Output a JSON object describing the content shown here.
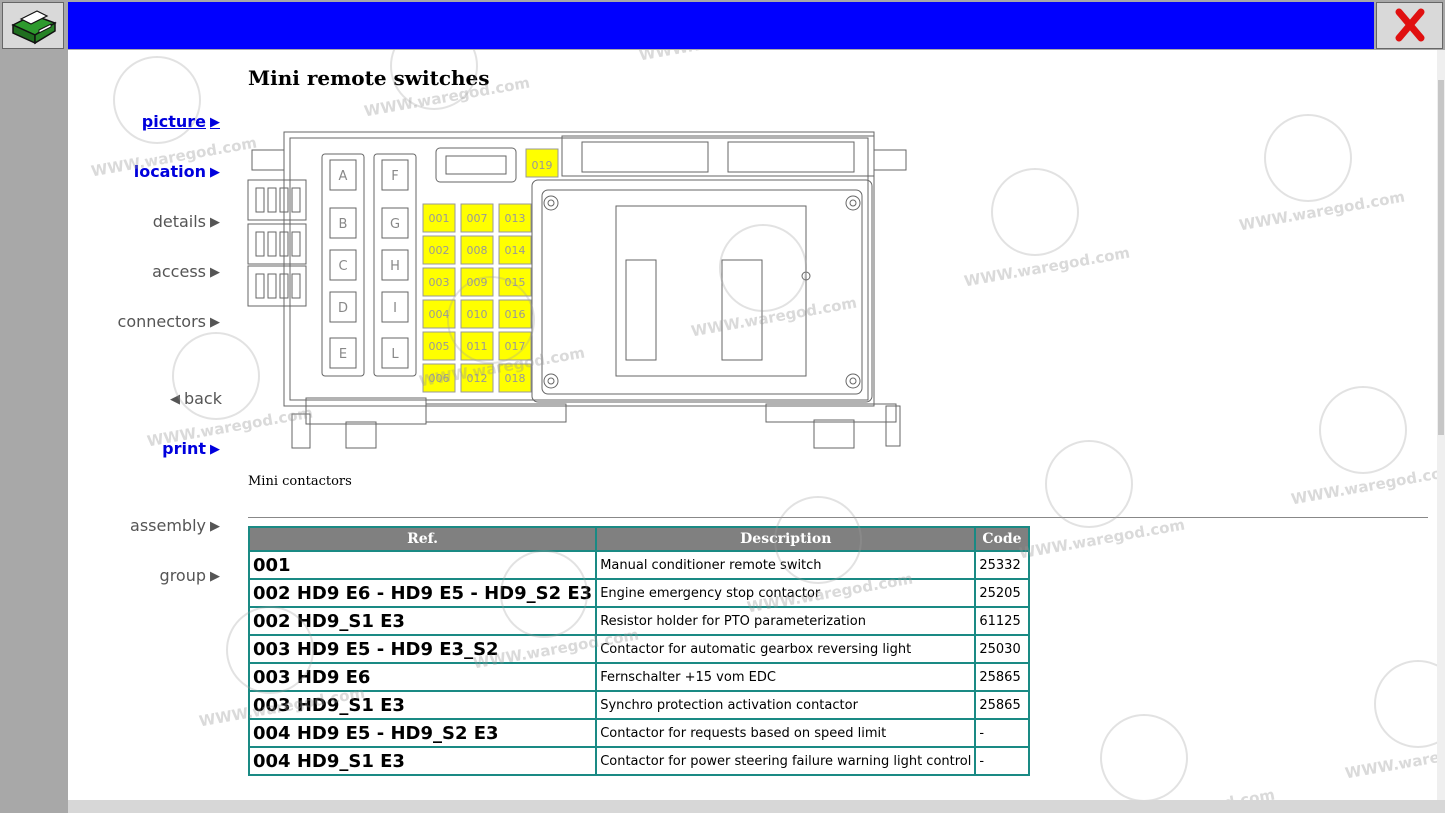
{
  "nav": {
    "picture": "picture",
    "location": "location",
    "details": "details",
    "access": "access",
    "connectors": "connectors",
    "back": "back",
    "print": "print",
    "assembly": "assembly",
    "group": "group"
  },
  "page": {
    "title": "Mini remote switches",
    "caption": "Mini contactors"
  },
  "diagram": {
    "fuse_labels_left": [
      "A",
      "B",
      "C",
      "D",
      "E"
    ],
    "fuse_labels_right": [
      "F",
      "G",
      "H",
      "I",
      "L"
    ],
    "yellow_labels": [
      "001",
      "007",
      "013",
      "002",
      "008",
      "014",
      "003",
      "009",
      "015",
      "004",
      "010",
      "016",
      "005",
      "011",
      "017",
      "006",
      "012",
      "018"
    ],
    "top_label": "019",
    "highlight_color": "#ffff00"
  },
  "table": {
    "headers": [
      "Ref.",
      "Description",
      "Code"
    ],
    "rows": [
      {
        "ref": "001",
        "desc": "Manual conditioner remote switch",
        "code": "25332"
      },
      {
        "ref": "002 HD9 E6 - HD9 E5 - HD9_S2 E3",
        "desc": "Engine emergency stop contactor",
        "code": "25205"
      },
      {
        "ref": "002 HD9_S1 E3",
        "desc": "Resistor holder for PTO parameterization",
        "code": "61125"
      },
      {
        "ref": "003 HD9 E5 - HD9 E3_S2",
        "desc": "Contactor for automatic gearbox reversing light",
        "code": "25030"
      },
      {
        "ref": "003 HD9 E6",
        "desc": "Fernschalter +15 vom EDC",
        "code": "25865"
      },
      {
        "ref": "003 HD9_S1 E3",
        "desc": "Synchro protection activation contactor",
        "code": "25865"
      },
      {
        "ref": "004 HD9 E5 - HD9_S2 E3",
        "desc": "Contactor for requests based on speed limit",
        "code": "-"
      },
      {
        "ref": "004 HD9_S1 E3",
        "desc": "Contactor for power steering failure warning light control",
        "code": "-"
      }
    ]
  },
  "watermark": {
    "text": "WWW.waregod.com"
  },
  "colors": {
    "topbar": "#0000ff",
    "table_border": "#1a8a84",
    "header_bg": "#808080",
    "nav_active": "#0000dd"
  }
}
